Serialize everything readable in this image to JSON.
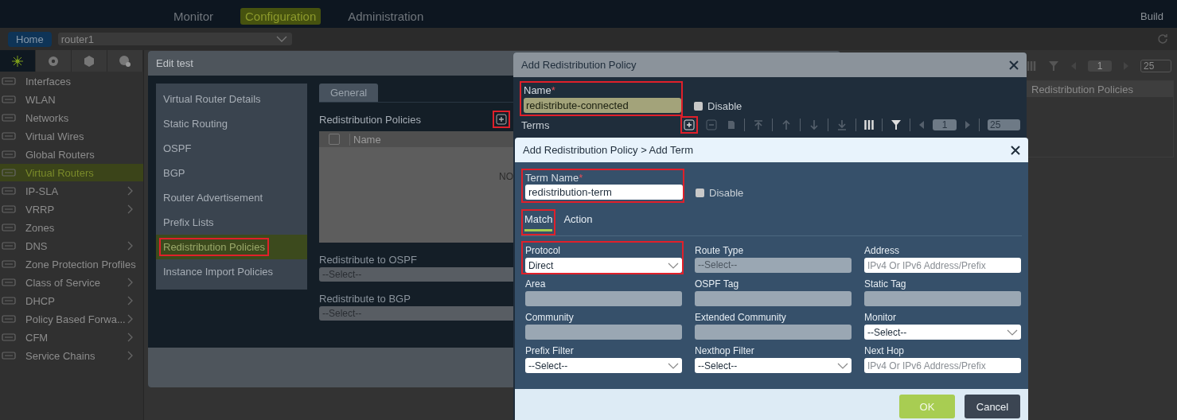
{
  "header": {
    "build": "Build",
    "tabs": [
      {
        "label": "Monitor",
        "selected": false
      },
      {
        "label": "Configuration",
        "selected": true
      },
      {
        "label": "Administration",
        "selected": false
      }
    ]
  },
  "breadcrumb": {
    "home": "Home",
    "device": "router1"
  },
  "sidebar": {
    "icon_tabs": [
      {
        "kind": "network",
        "selected": true
      },
      {
        "kind": "settings",
        "selected": false
      },
      {
        "kind": "objects",
        "selected": false
      },
      {
        "kind": "services",
        "selected": false
      }
    ],
    "items": [
      {
        "label": "Interfaces",
        "expandable": false,
        "selected": false
      },
      {
        "label": "WLAN",
        "expandable": false,
        "selected": false
      },
      {
        "label": "Networks",
        "expandable": false,
        "selected": false
      },
      {
        "label": "Virtual Wires",
        "expandable": false,
        "selected": false
      },
      {
        "label": "Global Routers",
        "expandable": false,
        "selected": false
      },
      {
        "label": "Virtual Routers",
        "expandable": false,
        "selected": true
      },
      {
        "label": "IP-SLA",
        "expandable": true,
        "selected": false
      },
      {
        "label": "VRRP",
        "expandable": true,
        "selected": false
      },
      {
        "label": "Zones",
        "expandable": false,
        "selected": false
      },
      {
        "label": "DNS",
        "expandable": true,
        "selected": false
      },
      {
        "label": "Zone Protection Profiles",
        "expandable": false,
        "selected": false
      },
      {
        "label": "Class of Service",
        "expandable": true,
        "selected": false
      },
      {
        "label": "DHCP",
        "expandable": true,
        "selected": false
      },
      {
        "label": "Policy Based Forwa...",
        "expandable": true,
        "selected": false
      },
      {
        "label": "CFM",
        "expandable": true,
        "selected": false
      },
      {
        "label": "Service Chains",
        "expandable": true,
        "selected": false
      }
    ]
  },
  "list_view": {
    "page": "1",
    "page_size": "25",
    "columns": [
      "Redistribution Policies"
    ]
  },
  "edit_window": {
    "title": "Edit test",
    "nav": [
      {
        "label": "Virtual Router Details",
        "selected": false,
        "highlighted": false
      },
      {
        "label": "Static Routing",
        "selected": false,
        "highlighted": false
      },
      {
        "label": "OSPF",
        "selected": false,
        "highlighted": false
      },
      {
        "label": "BGP",
        "selected": false,
        "highlighted": false
      },
      {
        "label": "Router Advertisement",
        "selected": false,
        "highlighted": false
      },
      {
        "label": "Prefix Lists",
        "selected": false,
        "highlighted": false
      },
      {
        "label": "Redistribution Policies",
        "selected": true,
        "highlighted": true
      },
      {
        "label": "Instance Import Policies",
        "selected": false,
        "highlighted": false
      }
    ],
    "tabs": [
      {
        "label": "General",
        "selected": true
      }
    ],
    "section": "Redistribution Policies",
    "add_highlighted": true,
    "select_all_checked": false,
    "columns": [
      "Name"
    ],
    "empty_text": "NO",
    "fields": [
      {
        "label": "Redistribute to OSPF",
        "value": "--Select--"
      },
      {
        "label": "Redistribute to BGP",
        "value": "--Select--"
      }
    ]
  },
  "policy_window": {
    "title": "Add Redistribution Policy",
    "name_label": "Name",
    "required_mark": "*",
    "name_value": "redistribute-connected",
    "name_highlighted": true,
    "disable_label": "Disable",
    "disable_checked": false,
    "terms_label": "Terms",
    "add_highlighted": true,
    "page": "1",
    "page_size": "25"
  },
  "term_window": {
    "title": "Add Redistribution Policy > Add Term",
    "name_label": "Term Name",
    "required_mark": "*",
    "name_value": "redistribution-term",
    "name_highlighted": true,
    "disable_label": "Disable",
    "disable_checked": false,
    "tabs": [
      {
        "label": "Match",
        "selected": true,
        "highlighted": true
      },
      {
        "label": "Action",
        "selected": false,
        "highlighted": false
      }
    ],
    "fields": [
      {
        "label": "Protocol",
        "kind": "select",
        "value": "Direct",
        "highlighted": true
      },
      {
        "label": "Route Type",
        "kind": "disabled",
        "value": "--Select--",
        "highlighted": false
      },
      {
        "label": "Address",
        "kind": "text",
        "placeholder": "IPv4 Or IPv6 Address/Prefix",
        "highlighted": false
      },
      {
        "label": "Area",
        "kind": "disabled",
        "highlighted": false
      },
      {
        "label": "OSPF Tag",
        "kind": "disabled",
        "highlighted": false
      },
      {
        "label": "Static Tag",
        "kind": "disabled",
        "highlighted": false
      },
      {
        "label": "Community",
        "kind": "disabled",
        "highlighted": false
      },
      {
        "label": "Extended Community",
        "kind": "disabled",
        "highlighted": false
      },
      {
        "label": "Monitor",
        "kind": "select",
        "value": "--Select--",
        "highlighted": false
      },
      {
        "label": "Prefix Filter",
        "kind": "select",
        "value": "--Select--",
        "highlighted": false
      },
      {
        "label": "Nexthop Filter",
        "kind": "select",
        "value": "--Select--",
        "highlighted": false
      },
      {
        "label": "Next Hop",
        "kind": "text",
        "placeholder": "IPv4 Or IPv6 Address/Prefix",
        "highlighted": false
      }
    ],
    "buttons": [
      {
        "label": "OK",
        "kind": "primary"
      },
      {
        "label": "Cancel",
        "kind": "secondary"
      }
    ]
  }
}
